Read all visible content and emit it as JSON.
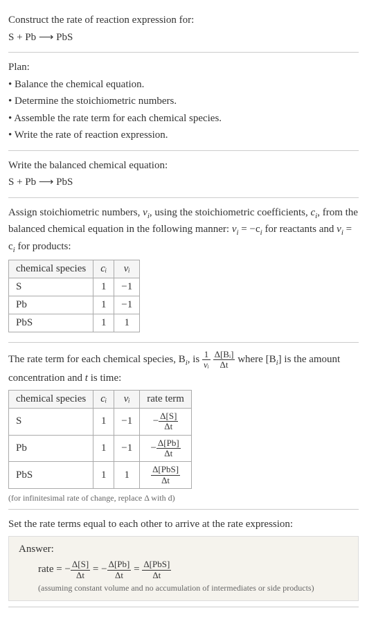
{
  "intro": {
    "prompt": "Construct the rate of reaction expression for:",
    "equation": "S + Pb ⟶ PbS"
  },
  "plan": {
    "title": "Plan:",
    "items": [
      "Balance the chemical equation.",
      "Determine the stoichiometric numbers.",
      "Assemble the rate term for each chemical species.",
      "Write the rate of reaction expression."
    ]
  },
  "balanced": {
    "title": "Write the balanced chemical equation:",
    "equation": "S + Pb ⟶ PbS"
  },
  "stoich": {
    "text_part1": "Assign stoichiometric numbers, ",
    "nu_i": "ν",
    "text_part2": ", using the stoichiometric coefficients, ",
    "c_i": "c",
    "text_part3": ", from the balanced chemical equation in the following manner: ",
    "rule1": "ν",
    "rule1_eq": " = −c",
    "rule1_end": " for reactants and ",
    "rule2": "ν",
    "rule2_eq": " = c",
    "rule2_end": " for products:",
    "table": {
      "headers": [
        "chemical species",
        "cᵢ",
        "νᵢ"
      ],
      "rows": [
        [
          "S",
          "1",
          "−1"
        ],
        [
          "Pb",
          "1",
          "−1"
        ],
        [
          "PbS",
          "1",
          "1"
        ]
      ]
    }
  },
  "rate_term": {
    "text_part1": "The rate term for each chemical species, B",
    "text_part2": ", is ",
    "text_part3": " where [B",
    "text_part4": "] is the amount concentration and ",
    "t_var": "t",
    "text_part5": " is time:",
    "frac1_num": "1",
    "frac1_den": "νᵢ",
    "frac2_num": "Δ[Bᵢ]",
    "frac2_den": "Δt",
    "table": {
      "headers": [
        "chemical species",
        "cᵢ",
        "νᵢ",
        "rate term"
      ],
      "rows": [
        {
          "species": "S",
          "c": "1",
          "nu": "−1",
          "sign": "−",
          "num": "Δ[S]",
          "den": "Δt"
        },
        {
          "species": "Pb",
          "c": "1",
          "nu": "−1",
          "sign": "−",
          "num": "Δ[Pb]",
          "den": "Δt"
        },
        {
          "species": "PbS",
          "c": "1",
          "nu": "1",
          "sign": "",
          "num": "Δ[PbS]",
          "den": "Δt"
        }
      ]
    },
    "note": "(for infinitesimal rate of change, replace Δ with d)"
  },
  "final": {
    "title": "Set the rate terms equal to each other to arrive at the rate expression:",
    "answer_label": "Answer:",
    "rate_label": "rate = ",
    "terms": [
      {
        "sign": "−",
        "num": "Δ[S]",
        "den": "Δt"
      },
      {
        "sign": "−",
        "num": "Δ[Pb]",
        "den": "Δt"
      },
      {
        "sign": "",
        "num": "Δ[PbS]",
        "den": "Δt"
      }
    ],
    "note": "(assuming constant volume and no accumulation of intermediates or side products)"
  }
}
